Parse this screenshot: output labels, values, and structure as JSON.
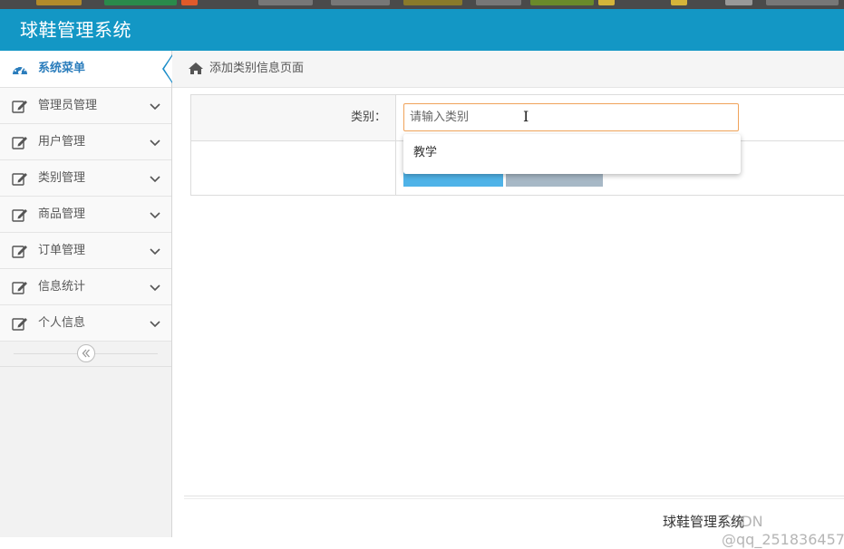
{
  "header": {
    "title": "球鞋管理系统"
  },
  "sidebar": {
    "head": {
      "label": "系统菜单",
      "icon": "dashboard-icon"
    },
    "items": [
      {
        "label": "管理员管理",
        "icon": "edit-icon"
      },
      {
        "label": "用户管理",
        "icon": "edit-icon"
      },
      {
        "label": "类别管理",
        "icon": "edit-icon"
      },
      {
        "label": "商品管理",
        "icon": "edit-icon"
      },
      {
        "label": "订单管理",
        "icon": "edit-icon"
      },
      {
        "label": "信息统计",
        "icon": "edit-icon"
      },
      {
        "label": "个人信息",
        "icon": "edit-icon"
      }
    ],
    "collapse_icon": "double-chevron-left-icon"
  },
  "breadcrumb": {
    "icon": "home-icon",
    "label": "添加类别信息页面"
  },
  "form": {
    "category_label": "类别：",
    "category_placeholder": "请输入类别",
    "category_value": "",
    "autocomplete": [
      "教学"
    ]
  },
  "footer": {
    "text": "球鞋管理系统",
    "watermark": "CSDN @qq_251836457"
  },
  "colors": {
    "header_bg": "#1397c5",
    "accent": "#2b7dbc",
    "submit_btn": "#4fb3e8",
    "reset_btn": "#a7b8c6",
    "input_focus_border": "#f0a35a"
  }
}
